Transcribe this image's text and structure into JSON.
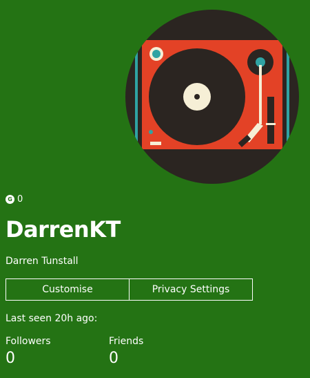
{
  "profile": {
    "gamerscore_icon": "G",
    "gamerscore": "0",
    "gamertag": "DarrenKT",
    "real_name": "Darren Tunstall",
    "last_seen": "Last seen 20h ago:"
  },
  "actions": {
    "customise_label": "Customise",
    "privacy_label": "Privacy Settings"
  },
  "stats": {
    "followers_label": "Followers",
    "followers_value": "0",
    "friends_label": "Friends",
    "friends_value": "0"
  },
  "colors": {
    "background": "#247314",
    "avatar_bg": "#2b2521",
    "turntable": "#e34226",
    "accent_teal": "#2fa3a3"
  }
}
